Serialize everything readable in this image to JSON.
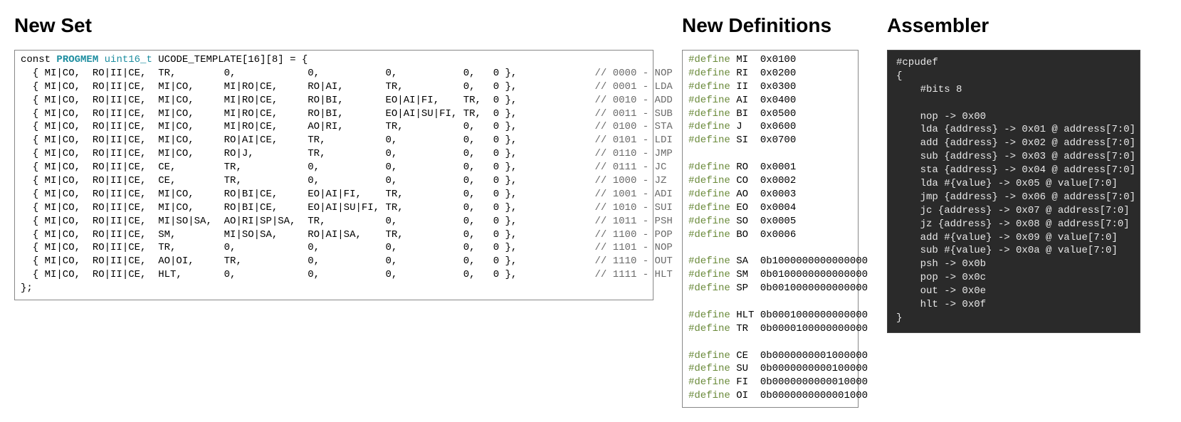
{
  "headings": {
    "newset": "New Set",
    "newdef": "New Definitions",
    "assembler": "Assembler"
  },
  "newset": {
    "decl_prefix": "const ",
    "decl_kw": "PROGMEM",
    "decl_type": "uint16_t",
    "decl_name": " UCODE_TEMPLATE[16][8] = {",
    "rows": [
      {
        "cells": [
          "MI|CO,",
          "RO|II|CE,",
          "TR,",
          "0,",
          "0,",
          "0,",
          "0,",
          "0 },"
        ],
        "comment": "// 0000 - NOP"
      },
      {
        "cells": [
          "MI|CO,",
          "RO|II|CE,",
          "MI|CO,",
          "MI|RO|CE,",
          "RO|AI,",
          "TR,",
          "0,",
          "0 },"
        ],
        "comment": "// 0001 - LDA"
      },
      {
        "cells": [
          "MI|CO,",
          "RO|II|CE,",
          "MI|CO,",
          "MI|RO|CE,",
          "RO|BI,",
          "EO|AI|FI,",
          "TR,",
          "0 },"
        ],
        "comment": "// 0010 - ADD"
      },
      {
        "cells": [
          "MI|CO,",
          "RO|II|CE,",
          "MI|CO,",
          "MI|RO|CE,",
          "RO|BI,",
          "EO|AI|SU|FI,",
          "TR,",
          "0 },"
        ],
        "comment": "// 0011 - SUB"
      },
      {
        "cells": [
          "MI|CO,",
          "RO|II|CE,",
          "MI|CO,",
          "MI|RO|CE,",
          "AO|RI,",
          "TR,",
          "0,",
          "0 },"
        ],
        "comment": "// 0100 - STA"
      },
      {
        "cells": [
          "MI|CO,",
          "RO|II|CE,",
          "MI|CO,",
          "RO|AI|CE,",
          "TR,",
          "0,",
          "0,",
          "0 },"
        ],
        "comment": "// 0101 - LDI"
      },
      {
        "cells": [
          "MI|CO,",
          "RO|II|CE,",
          "MI|CO,",
          "RO|J,",
          "TR,",
          "0,",
          "0,",
          "0 },"
        ],
        "comment": "// 0110 - JMP"
      },
      {
        "cells": [
          "MI|CO,",
          "RO|II|CE,",
          "CE,",
          "TR,",
          "0,",
          "0,",
          "0,",
          "0 },"
        ],
        "comment": "// 0111 - JC"
      },
      {
        "cells": [
          "MI|CO,",
          "RO|II|CE,",
          "CE,",
          "TR,",
          "0,",
          "0,",
          "0,",
          "0 },"
        ],
        "comment": "// 1000 - JZ"
      },
      {
        "cells": [
          "MI|CO,",
          "RO|II|CE,",
          "MI|CO,",
          "RO|BI|CE,",
          "EO|AI|FI,",
          "TR,",
          "0,",
          "0 },"
        ],
        "comment": "// 1001 - ADI"
      },
      {
        "cells": [
          "MI|CO,",
          "RO|II|CE,",
          "MI|CO,",
          "RO|BI|CE,",
          "EO|AI|SU|FI,",
          "TR,",
          "0,",
          "0 },"
        ],
        "comment": "// 1010 - SUI"
      },
      {
        "cells": [
          "MI|CO,",
          "RO|II|CE,",
          "MI|SO|SA,",
          "AO|RI|SP|SA,",
          "TR,",
          "0,",
          "0,",
          "0 },"
        ],
        "comment": "// 1011 - PSH"
      },
      {
        "cells": [
          "MI|CO,",
          "RO|II|CE,",
          "SM,",
          "MI|SO|SA,",
          "RO|AI|SA,",
          "TR,",
          "0,",
          "0 },"
        ],
        "comment": "// 1100 - POP"
      },
      {
        "cells": [
          "MI|CO,",
          "RO|II|CE,",
          "TR,",
          "0,",
          "0,",
          "0,",
          "0,",
          "0 },"
        ],
        "comment": "// 1101 - NOP"
      },
      {
        "cells": [
          "MI|CO,",
          "RO|II|CE,",
          "AO|OI,",
          "TR,",
          "0,",
          "0,",
          "0,",
          "0 },"
        ],
        "comment": "// 1110 - OUT"
      },
      {
        "cells": [
          "MI|CO,",
          "RO|II|CE,",
          "HLT,",
          "0,",
          "0,",
          "0,",
          "0,",
          "0 },"
        ],
        "comment": "// 1111 - HLT"
      }
    ],
    "close": "};",
    "widths": [
      8,
      11,
      11,
      14,
      13,
      13,
      5,
      6
    ],
    "comment_pad": 11
  },
  "newdef": {
    "groups": [
      [
        {
          "name": "MI",
          "val": "0x0100"
        },
        {
          "name": "RI",
          "val": "0x0200"
        },
        {
          "name": "II",
          "val": "0x0300"
        },
        {
          "name": "AI",
          "val": "0x0400"
        },
        {
          "name": "BI",
          "val": "0x0500"
        },
        {
          "name": "J",
          "val": "0x0600"
        },
        {
          "name": "SI",
          "val": "0x0700"
        }
      ],
      [
        {
          "name": "RO",
          "val": "0x0001"
        },
        {
          "name": "CO",
          "val": "0x0002"
        },
        {
          "name": "AO",
          "val": "0x0003"
        },
        {
          "name": "EO",
          "val": "0x0004"
        },
        {
          "name": "SO",
          "val": "0x0005"
        },
        {
          "name": "BO",
          "val": "0x0006"
        }
      ],
      [
        {
          "name": "SA",
          "val": "0b1000000000000000"
        },
        {
          "name": "SM",
          "val": "0b0100000000000000"
        },
        {
          "name": "SP",
          "val": "0b0010000000000000"
        }
      ],
      [
        {
          "name": "HLT",
          "val": "0b0001000000000000"
        },
        {
          "name": "TR",
          "val": "0b0000100000000000"
        }
      ],
      [
        {
          "name": "CE",
          "val": "0b0000000001000000"
        },
        {
          "name": "SU",
          "val": "0b0000000000100000"
        },
        {
          "name": "FI",
          "val": "0b0000000000010000"
        },
        {
          "name": "OI",
          "val": "0b0000000000001000"
        }
      ]
    ]
  },
  "assembler": {
    "header": "#cpudef",
    "open": "{",
    "bits": "    #bits 8",
    "lines": [
      "    nop -> 0x00",
      "    lda {address} -> 0x01 @ address[7:0]",
      "    add {address} -> 0x02 @ address[7:0]",
      "    sub {address} -> 0x03 @ address[7:0]",
      "    sta {address} -> 0x04 @ address[7:0]",
      "    lda #{value} -> 0x05 @ value[7:0]",
      "    jmp {address} -> 0x06 @ address[7:0]",
      "    jc {address} -> 0x07 @ address[7:0]",
      "    jz {address} -> 0x08 @ address[7:0]",
      "    add #{value} -> 0x09 @ value[7:0]",
      "    sub #{value} -> 0x0a @ value[7:0]",
      "    psh -> 0x0b",
      "    pop -> 0x0c",
      "    out -> 0x0e",
      "    hlt -> 0x0f"
    ],
    "close": "}"
  }
}
